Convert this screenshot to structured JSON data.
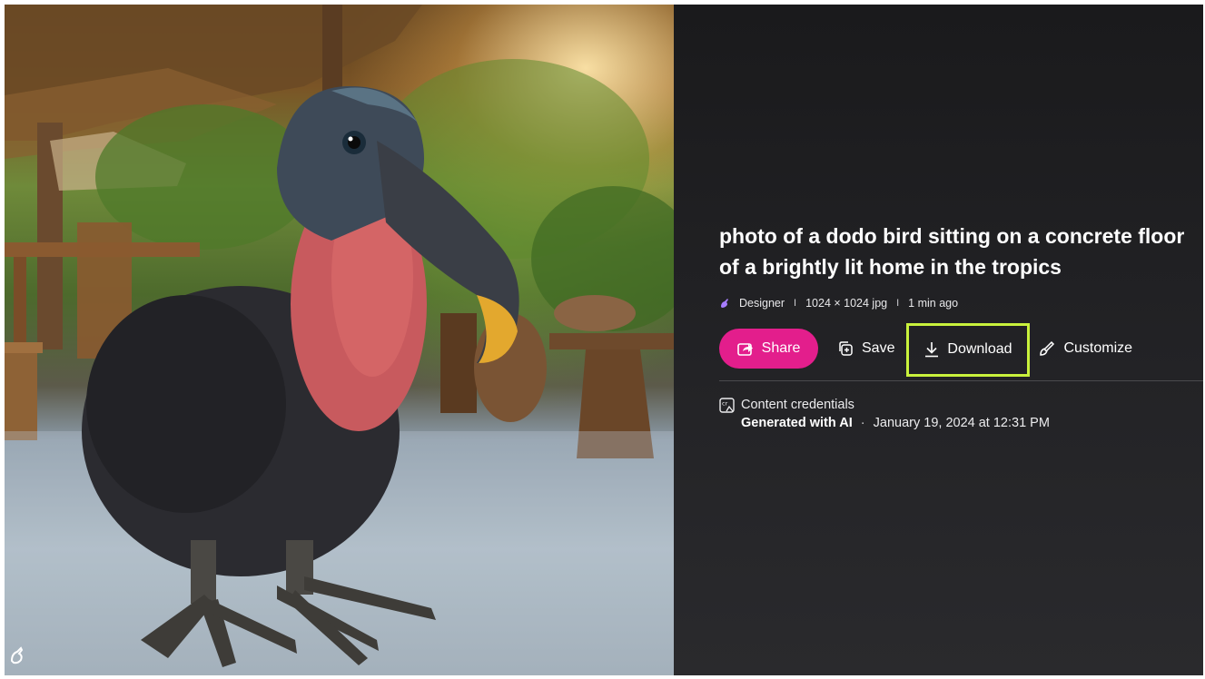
{
  "prompt": {
    "line1": "photo of a dodo bird sitting on a concrete floor",
    "line2": "of a brightly lit home in the tropics"
  },
  "meta": {
    "app_name": "Designer",
    "image_info": "1024 × 1024 jpg",
    "time_ago": "1 min ago",
    "separator": "I"
  },
  "actions": {
    "share_label": "Share",
    "save_label": "Save",
    "download_label": "Download",
    "customize_label": "Customize"
  },
  "credentials": {
    "heading": "Content credentials",
    "generated_label": "Generated with AI",
    "dot": "·",
    "timestamp": "January 19, 2024 at 12:31 PM"
  },
  "colors": {
    "share_bg": "#e31e8c",
    "highlight_border": "#c9f23c",
    "panel_bg": "#1c1c1e"
  },
  "icons": {
    "share": "share-arrow-icon",
    "save": "save-collection-icon",
    "download": "download-icon",
    "customize": "customize-brush-icon",
    "credentials": "content-credentials-icon",
    "designer": "designer-logo-icon"
  }
}
